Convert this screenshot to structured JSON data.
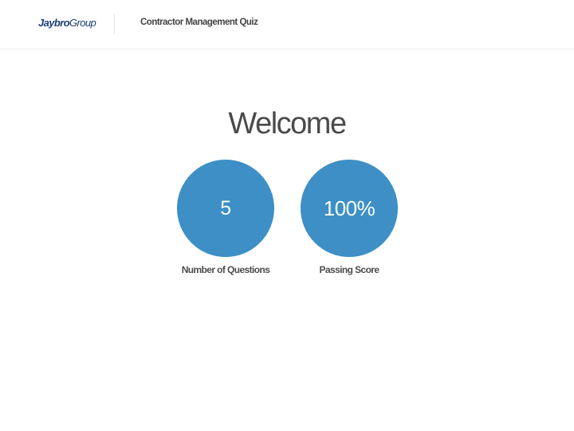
{
  "header": {
    "logo": {
      "brand": "Jaybro",
      "suffix": "Group"
    },
    "title": "Contractor Management Quiz"
  },
  "main": {
    "heading": "Welcome",
    "stats": [
      {
        "value": "5",
        "label": "Number of Questions"
      },
      {
        "value": "100%",
        "label": "Passing Score"
      }
    ]
  },
  "colors": {
    "accent": "#3d8fc6",
    "brand": "#1c3f7a",
    "text": "#4a4a4a"
  }
}
